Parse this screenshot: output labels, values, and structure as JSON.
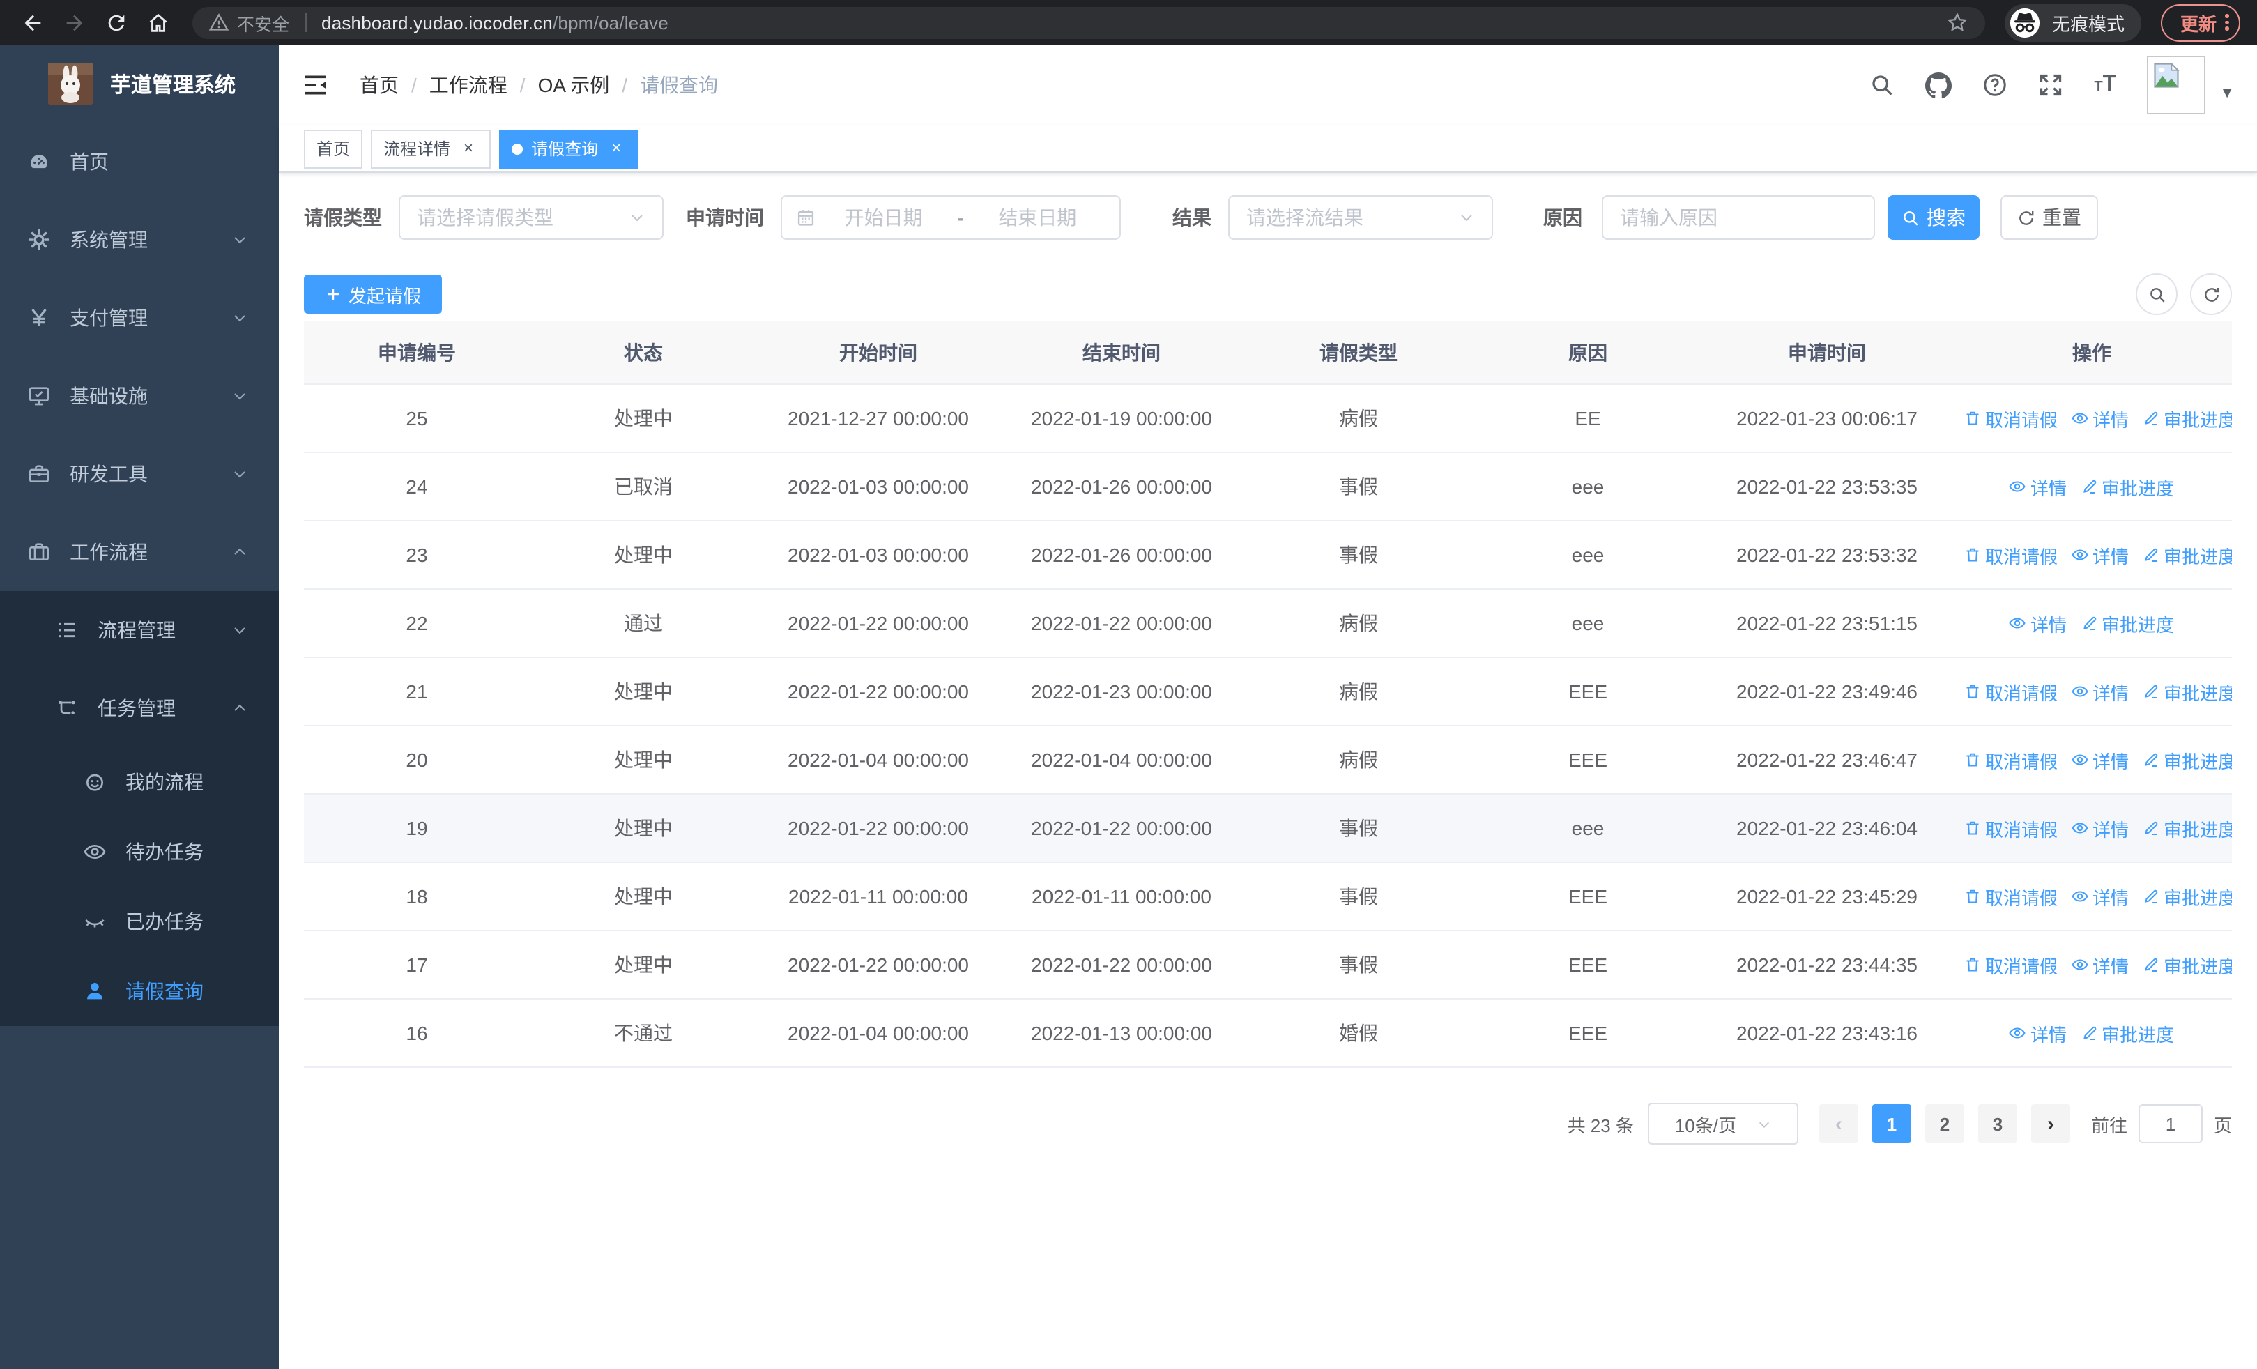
{
  "browser": {
    "security_label": "不安全",
    "url_host": "dashboard.yudao.iocoder.cn",
    "url_path": "/bpm/oa/leave",
    "incognito_label": "无痕模式",
    "update_label": "更新"
  },
  "sidebar": {
    "title": "芋道管理系统",
    "items": [
      {
        "label": "首页",
        "icon": "dashboard-icon",
        "level": 1
      },
      {
        "label": "系统管理",
        "icon": "gear-icon",
        "level": 1,
        "chevron": "down"
      },
      {
        "label": "支付管理",
        "icon": "yen-icon",
        "level": 1,
        "chevron": "down"
      },
      {
        "label": "基础设施",
        "icon": "monitor-icon",
        "level": 1,
        "chevron": "down"
      },
      {
        "label": "研发工具",
        "icon": "toolbox-icon",
        "level": 1,
        "chevron": "down"
      },
      {
        "label": "工作流程",
        "icon": "briefcase-icon",
        "level": 1,
        "chevron": "up"
      },
      {
        "label": "流程管理",
        "icon": "list-icon",
        "level": 2,
        "chevron": "down",
        "in_expanded": true
      },
      {
        "label": "任务管理",
        "icon": "tree-icon",
        "level": 2,
        "chevron": "up",
        "in_expanded": true
      },
      {
        "label": "我的流程",
        "icon": "face-icon",
        "level": 3,
        "in_expanded": true
      },
      {
        "label": "待办任务",
        "icon": "eye-open-icon",
        "level": 3,
        "in_expanded": true
      },
      {
        "label": "已办任务",
        "icon": "eye-closed-icon",
        "level": 3,
        "in_expanded": true
      },
      {
        "label": "请假查询",
        "icon": "user-icon",
        "level": 3,
        "in_expanded": true,
        "active": true
      }
    ]
  },
  "header": {
    "breadcrumb": [
      "首页",
      "工作流程",
      "OA 示例",
      "请假查询"
    ]
  },
  "tabs": [
    {
      "label": "首页",
      "active": false,
      "closable": false
    },
    {
      "label": "流程详情",
      "active": false,
      "closable": true
    },
    {
      "label": "请假查询",
      "active": true,
      "closable": true
    }
  ],
  "filters": {
    "leave_type_label": "请假类型",
    "leave_type_placeholder": "请选择请假类型",
    "apply_time_label": "申请时间",
    "date_start_placeholder": "开始日期",
    "date_separator": "-",
    "date_end_placeholder": "结束日期",
    "result_label": "结果",
    "result_placeholder": "请选择流结果",
    "reason_label": "原因",
    "reason_placeholder": "请输入原因",
    "search_label": "搜索",
    "reset_label": "重置"
  },
  "toolbar": {
    "create_label": "发起请假"
  },
  "table": {
    "columns": [
      "申请编号",
      "状态",
      "开始时间",
      "结束时间",
      "请假类型",
      "原因",
      "申请时间",
      "操作"
    ],
    "action_labels": {
      "cancel": "取消请假",
      "detail": "详情",
      "progress": "审批进度"
    },
    "rows": [
      {
        "id": "25",
        "status": "处理中",
        "start": "2021-12-27 00:00:00",
        "end": "2022-01-19 00:00:00",
        "type": "病假",
        "reason": "EE",
        "applied": "2022-01-23 00:06:17",
        "actions": [
          "cancel",
          "detail",
          "progress"
        ]
      },
      {
        "id": "24",
        "status": "已取消",
        "start": "2022-01-03 00:00:00",
        "end": "2022-01-26 00:00:00",
        "type": "事假",
        "reason": "eee",
        "applied": "2022-01-22 23:53:35",
        "actions": [
          "detail",
          "progress"
        ]
      },
      {
        "id": "23",
        "status": "处理中",
        "start": "2022-01-03 00:00:00",
        "end": "2022-01-26 00:00:00",
        "type": "事假",
        "reason": "eee",
        "applied": "2022-01-22 23:53:32",
        "actions": [
          "cancel",
          "detail",
          "progress"
        ]
      },
      {
        "id": "22",
        "status": "通过",
        "start": "2022-01-22 00:00:00",
        "end": "2022-01-22 00:00:00",
        "type": "病假",
        "reason": "eee",
        "applied": "2022-01-22 23:51:15",
        "actions": [
          "detail",
          "progress"
        ]
      },
      {
        "id": "21",
        "status": "处理中",
        "start": "2022-01-22 00:00:00",
        "end": "2022-01-23 00:00:00",
        "type": "病假",
        "reason": "EEE",
        "applied": "2022-01-22 23:49:46",
        "actions": [
          "cancel",
          "detail",
          "progress"
        ]
      },
      {
        "id": "20",
        "status": "处理中",
        "start": "2022-01-04 00:00:00",
        "end": "2022-01-04 00:00:00",
        "type": "病假",
        "reason": "EEE",
        "applied": "2022-01-22 23:46:47",
        "actions": [
          "cancel",
          "detail",
          "progress"
        ]
      },
      {
        "id": "19",
        "status": "处理中",
        "start": "2022-01-22 00:00:00",
        "end": "2022-01-22 00:00:00",
        "type": "事假",
        "reason": "eee",
        "applied": "2022-01-22 23:46:04",
        "actions": [
          "cancel",
          "detail",
          "progress"
        ],
        "highlighted": true
      },
      {
        "id": "18",
        "status": "处理中",
        "start": "2022-01-11 00:00:00",
        "end": "2022-01-11 00:00:00",
        "type": "事假",
        "reason": "EEE",
        "applied": "2022-01-22 23:45:29",
        "actions": [
          "cancel",
          "detail",
          "progress"
        ]
      },
      {
        "id": "17",
        "status": "处理中",
        "start": "2022-01-22 00:00:00",
        "end": "2022-01-22 00:00:00",
        "type": "事假",
        "reason": "EEE",
        "applied": "2022-01-22 23:44:35",
        "actions": [
          "cancel",
          "detail",
          "progress"
        ]
      },
      {
        "id": "16",
        "status": "不通过",
        "start": "2022-01-04 00:00:00",
        "end": "2022-01-13 00:00:00",
        "type": "婚假",
        "reason": "EEE",
        "applied": "2022-01-22 23:43:16",
        "actions": [
          "detail",
          "progress"
        ]
      }
    ]
  },
  "pagination": {
    "total_label": "共 23 条",
    "page_size": "10条/页",
    "pages": [
      "1",
      "2",
      "3"
    ],
    "active_page": "1",
    "goto_label": "前往",
    "goto_value": "1",
    "page_suffix_label": "页"
  },
  "colors": {
    "primary": "#409eff",
    "sidebar_bg": "#304156",
    "submenu_bg": "#1f2d3d",
    "update_button": "#f28b82"
  }
}
